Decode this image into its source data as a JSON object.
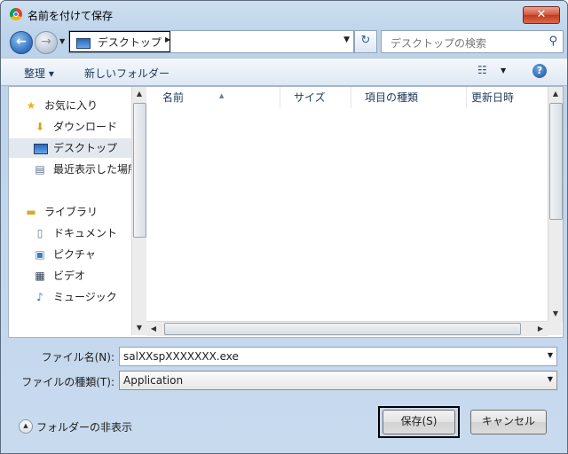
{
  "window": {
    "title": "名前を付けて保存",
    "close_label": "✕"
  },
  "address": {
    "location": "デスクトップ",
    "search_placeholder": "デスクトップの検索"
  },
  "toolbar": {
    "organize_label": "整理 ▾",
    "new_folder_label": "新しいフォルダー"
  },
  "nav": {
    "items": [
      {
        "label": "お気に入り",
        "icon": "star-icon"
      },
      {
        "label": "ダウンロード",
        "icon": "downloads-icon"
      },
      {
        "label": "デスクトップ",
        "icon": "desktop-icon",
        "selected": true
      },
      {
        "label": "最近表示した場所",
        "icon": "recent-places-icon"
      },
      {
        "label": "ライブラリ",
        "icon": "library-icon"
      },
      {
        "label": "ドキュメント",
        "icon": "documents-icon"
      },
      {
        "label": "ピクチャ",
        "icon": "pictures-icon"
      },
      {
        "label": "ビデオ",
        "icon": "videos-icon"
      },
      {
        "label": "ミュージック",
        "icon": "music-icon"
      }
    ]
  },
  "columns": {
    "name": "名前",
    "size": "サイズ",
    "type": "項目の種類",
    "date": "更新日時"
  },
  "form": {
    "filename_label": "ファイル名(N):",
    "filename_value": "salXXspXXXXXXX.exe",
    "filetype_label": "ファイルの種類(T):",
    "filetype_value": "Application"
  },
  "footer": {
    "hide_folders_label": "フォルダーの非表示",
    "save_label": "保存(S)",
    "cancel_label": "キャンセル"
  },
  "colors": {
    "accent": "#2f6fbf",
    "chrome": "#c8daee",
    "close": "#c23a1d"
  }
}
